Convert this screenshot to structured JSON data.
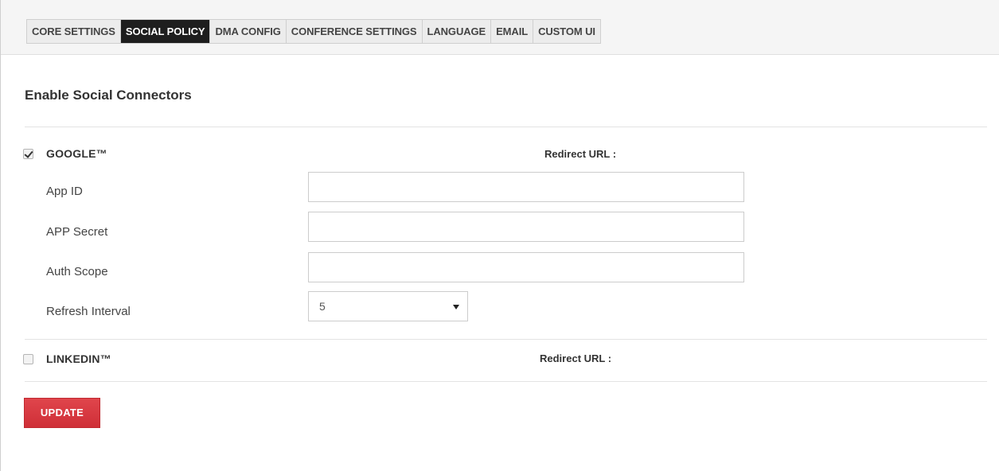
{
  "tabs": [
    {
      "label": "CORE SETTINGS",
      "active": false
    },
    {
      "label": "SOCIAL POLICY",
      "active": true
    },
    {
      "label": "DMA CONFIG",
      "active": false
    },
    {
      "label": "CONFERENCE SETTINGS",
      "active": false
    },
    {
      "label": "LANGUAGE",
      "active": false
    },
    {
      "label": "EMAIL",
      "active": false
    },
    {
      "label": "CUSTOM UI",
      "active": false
    }
  ],
  "section": {
    "title": "Enable Social Connectors"
  },
  "google": {
    "name": "GOOGLE™",
    "checked": true,
    "redirect_label": "Redirect URL :",
    "fields": {
      "app_id": {
        "label": "App ID",
        "value": ""
      },
      "app_secret": {
        "label": "APP Secret",
        "value": ""
      },
      "auth_scope": {
        "label": "Auth Scope",
        "value": ""
      },
      "refresh_interval": {
        "label": "Refresh Interval",
        "value": "5"
      }
    }
  },
  "linkedin": {
    "name": "LINKEDIN™",
    "checked": false,
    "redirect_label": "Redirect URL :"
  },
  "actions": {
    "update_label": "UPDATE"
  },
  "colors": {
    "active_tab_bg": "#1e1e1e",
    "update_button": "#d9363e"
  }
}
